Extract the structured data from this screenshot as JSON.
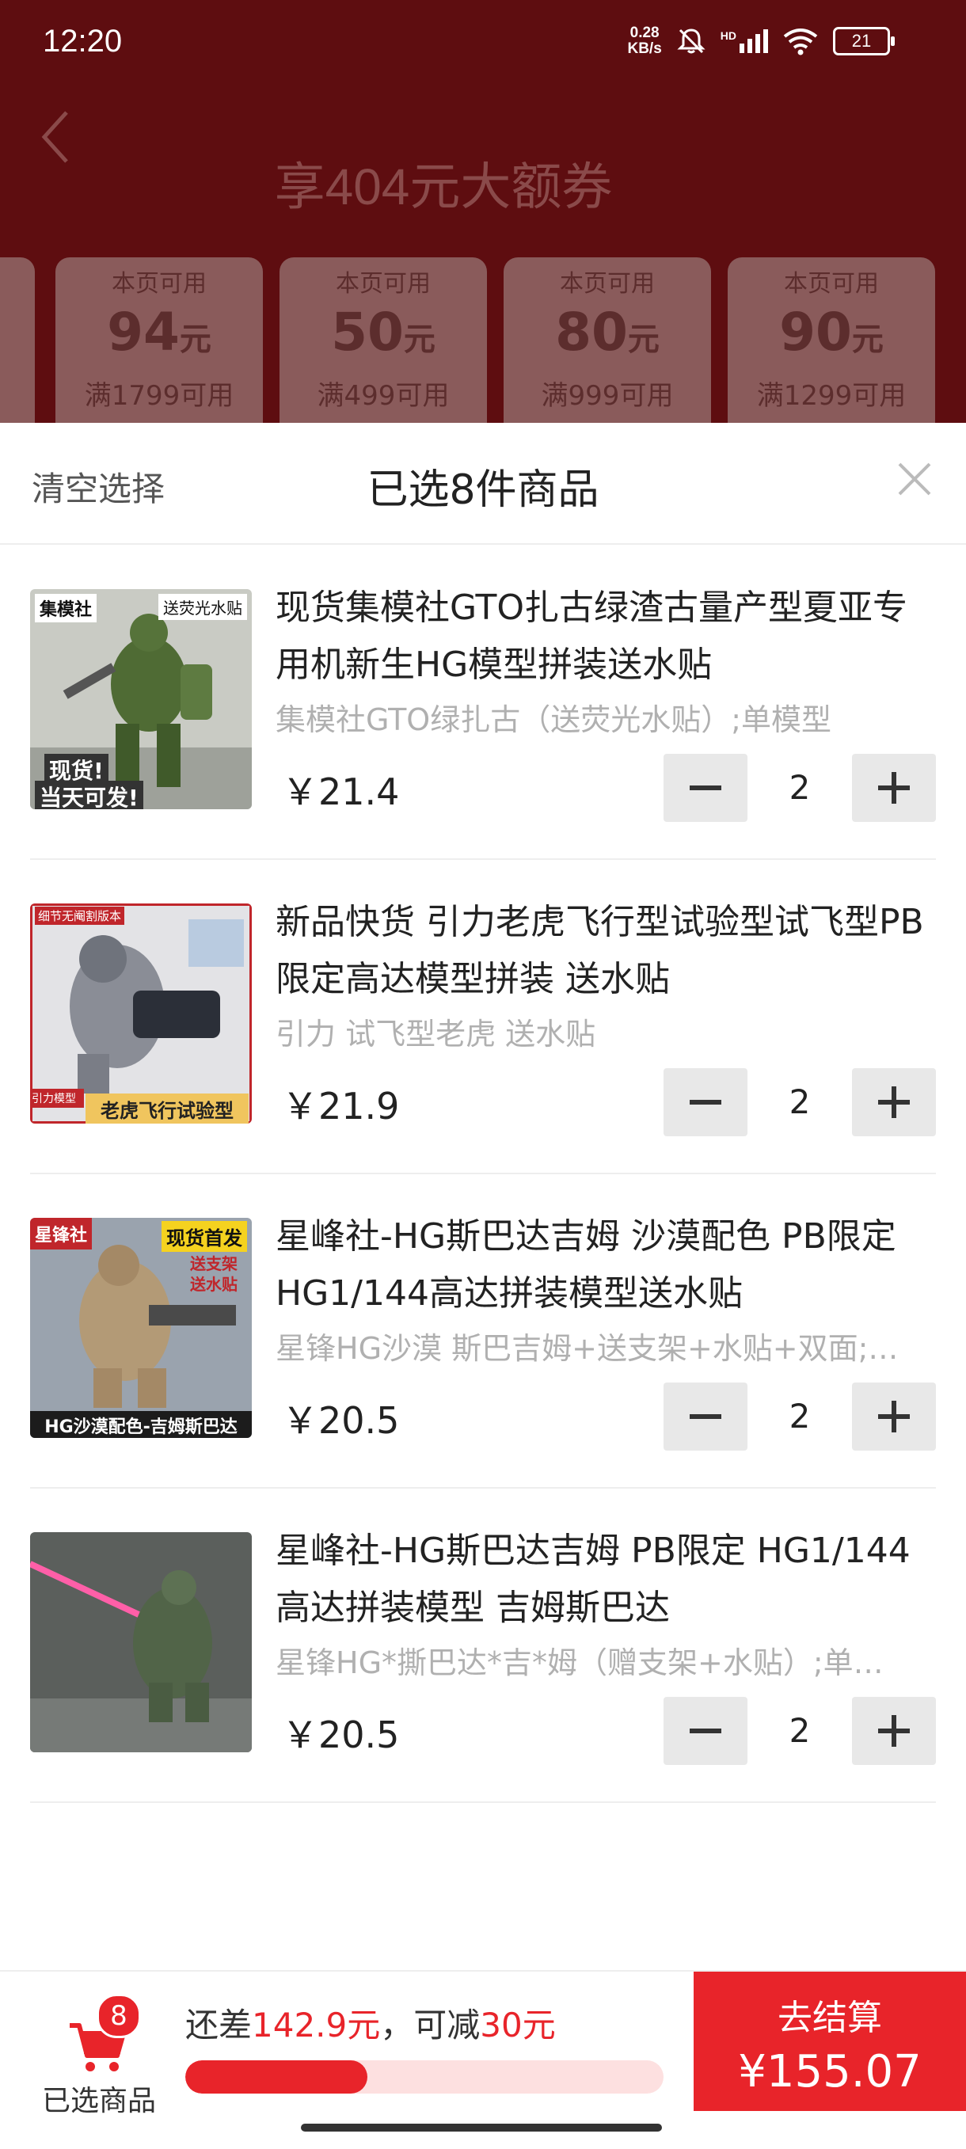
{
  "status_bar": {
    "time": "12:20",
    "net_speed_value": "0.28",
    "net_speed_unit": "KB/s",
    "signal_label": "HD",
    "battery": "21"
  },
  "page": {
    "title": "享404元大额券"
  },
  "coupons": [
    {
      "top": "本页可用",
      "amount": "94",
      "unit": "元",
      "condition": "满1799可用"
    },
    {
      "top": "本页可用",
      "amount": "50",
      "unit": "元",
      "condition": "满499可用"
    },
    {
      "top": "本页可用",
      "amount": "80",
      "unit": "元",
      "condition": "满999可用"
    },
    {
      "top": "本页可用",
      "amount": "90",
      "unit": "元",
      "condition": "满1299可用"
    }
  ],
  "sheet": {
    "clear_label": "清空选择",
    "title": "已选8件商品"
  },
  "items": [
    {
      "title": "现货集模社GTO扎古绿渣古量产型夏亚专用机新生HG模型拼装送水贴",
      "spec": "集模社GTO绿扎古（送荧光水贴）;单模型",
      "price": "￥21.4",
      "qty": "2",
      "thumb_tags": [
        "集模社",
        "送荧光水贴",
        "现货!",
        "当天可发!"
      ]
    },
    {
      "title": "新品快货 引力老虎飞行型试验型试飞型PB限定高达模型拼装 送水贴",
      "spec": "引力 试飞型老虎 送水贴",
      "price": "￥21.9",
      "qty": "2",
      "thumb_tags": [
        "细节无阉割版本",
        "引力模型",
        "老虎飞行试验型"
      ]
    },
    {
      "title": "星峰社-HG斯巴达吉姆 沙漠配色 PB限定HG1/144高达拼装模型送水贴",
      "spec": "星锋HG沙漠 斯巴吉姆+送支架+水贴+双面;…",
      "price": "￥20.5",
      "qty": "2",
      "thumb_tags": [
        "星锋社",
        "现货首发",
        "送支架",
        "送水贴",
        "HG沙漠配色-吉姆斯巴达"
      ]
    },
    {
      "title": "星峰社-HG斯巴达吉姆 PB限定 HG1/144高达拼装模型 吉姆斯巴达",
      "spec": "星锋HG*撕巴达*吉*姆（赠支架+水贴）;单…",
      "price": "￥20.5",
      "qty": "2",
      "thumb_tags": []
    }
  ],
  "bottom": {
    "cart_badge": "8",
    "cart_label": "已选商品",
    "promo_prefix": "还差",
    "promo_gap": "142.9元",
    "promo_mid": "，可减",
    "promo_discount": "30元",
    "progress_fraction": 0.38,
    "checkout_label": "去结算",
    "checkout_total": "¥155.07"
  },
  "colors": {
    "accent": "#e8242a",
    "overlay_bg": "#5e0d10",
    "stepper_bg": "#e8e8e8"
  }
}
